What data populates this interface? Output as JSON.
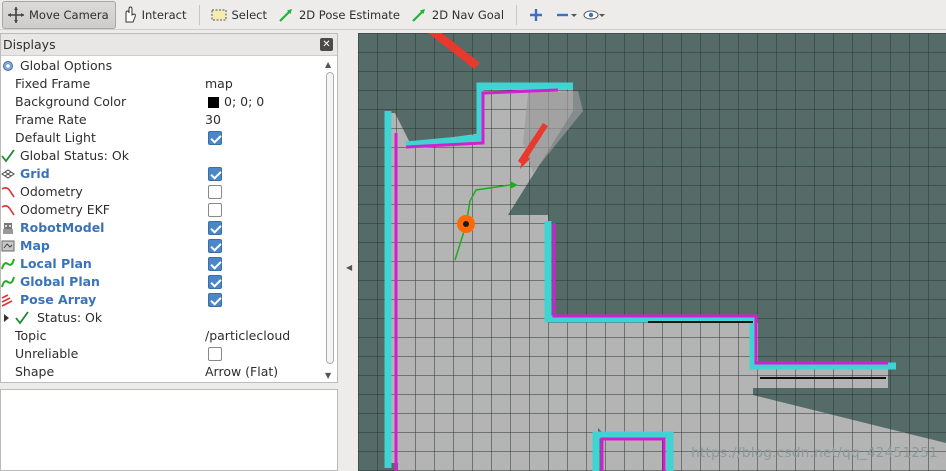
{
  "toolbar": {
    "move_camera": "Move Camera",
    "interact": "Interact",
    "select": "Select",
    "pose_estimate": "2D Pose Estimate",
    "nav_goal": "2D Nav Goal"
  },
  "displays": {
    "title": "Displays",
    "rows": [
      {
        "name": "Global Options",
        "value": "",
        "checked": null
      },
      {
        "name": "Fixed Frame",
        "value": "map",
        "checked": null
      },
      {
        "name": "Background Color",
        "value": "0; 0; 0",
        "checked": null
      },
      {
        "name": "Frame Rate",
        "value": "30",
        "checked": null
      },
      {
        "name": "Default Light",
        "value": "",
        "checked": true
      },
      {
        "name": "Global Status: Ok",
        "value": "",
        "checked": null
      },
      {
        "name": "Grid",
        "value": "",
        "checked": true
      },
      {
        "name": "Odometry",
        "value": "",
        "checked": false
      },
      {
        "name": "Odometry EKF",
        "value": "",
        "checked": false
      },
      {
        "name": "RobotModel",
        "value": "",
        "checked": true
      },
      {
        "name": "Map",
        "value": "",
        "checked": true
      },
      {
        "name": "Local Plan",
        "value": "",
        "checked": true
      },
      {
        "name": "Global Plan",
        "value": "",
        "checked": true
      },
      {
        "name": "Pose Array",
        "value": "",
        "checked": true
      },
      {
        "name": "Status: Ok",
        "value": "",
        "checked": null
      },
      {
        "name": "Topic",
        "value": "/particlecloud",
        "checked": null
      },
      {
        "name": "Unreliable",
        "value": "",
        "checked": false
      },
      {
        "name": "Shape",
        "value": "Arrow (Flat)",
        "checked": null
      }
    ]
  },
  "watermark": "https://blog.csdn.net/qq_42451251",
  "colors": {
    "map_unknown": "#556b68",
    "map_free": "#b3b3b3",
    "costmap_inflation": "#3fd3d3",
    "costmap_lethal": "#d21fd2",
    "plan": "#22aa22",
    "robot": "#ff6a00",
    "annotation_arrow": "#e8392e"
  },
  "icons": [
    "move-camera-icon",
    "interact-icon",
    "select-icon",
    "pose-estimate-icon",
    "nav-goal-icon",
    "add-tool-icon",
    "remove-tool-icon",
    "view-icon"
  ]
}
